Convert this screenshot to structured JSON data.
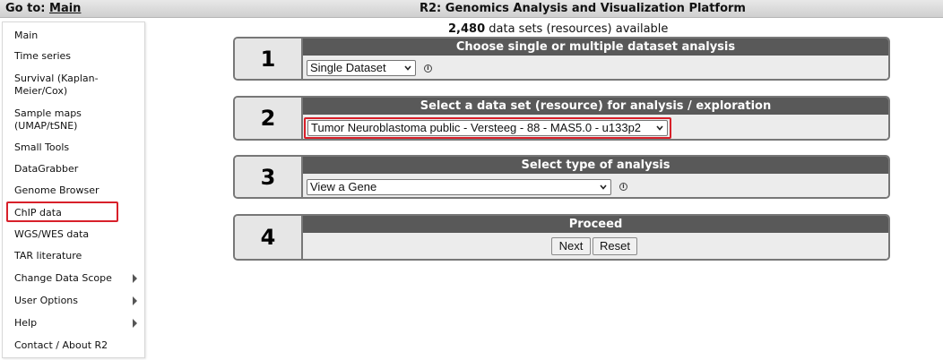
{
  "topbar": {
    "goto_label": "Go to:",
    "goto_link": "Main",
    "title": "R2: Genomics Analysis and Visualization Platform"
  },
  "sidebar": {
    "items": [
      {
        "label": "Main"
      },
      {
        "label": "Time series"
      },
      {
        "label": "Survival (Kaplan-\nMeier/Cox)"
      },
      {
        "label": "Sample maps\n(UMAP/tSNE)"
      },
      {
        "label": "Small Tools"
      },
      {
        "label": "DataGrabber"
      },
      {
        "label": "Genome Browser"
      },
      {
        "label": "ChIP data"
      },
      {
        "label": "WGS/WES data"
      },
      {
        "label": "TAR literature"
      },
      {
        "label": "Change Data Scope"
      },
      {
        "label": "User Options"
      },
      {
        "label": "Help"
      },
      {
        "label": "Contact / About R2"
      }
    ]
  },
  "main": {
    "count": "2,480",
    "count_suffix": " data sets (resources) available",
    "steps": [
      {
        "number": "1",
        "title": "Choose single or multiple dataset analysis",
        "select_value": "Single Dataset"
      },
      {
        "number": "2",
        "title": "Select a data set (resource) for analysis / exploration",
        "select_value": "Tumor Neuroblastoma public - Versteeg - 88 - MAS5.0 - u133p2"
      },
      {
        "number": "3",
        "title": "Select type of analysis",
        "select_value": "View a Gene"
      },
      {
        "number": "4",
        "title": "Proceed"
      }
    ],
    "buttons": {
      "next": "Next",
      "reset": "Reset"
    },
    "info_glyph": "i"
  },
  "colors": {
    "highlight": "#d8202a",
    "step_header": "#595959"
  }
}
